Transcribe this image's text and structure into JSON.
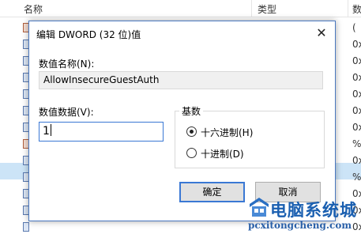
{
  "list": {
    "header": {
      "name": "名称",
      "type": "类型",
      "data": "数"
    },
    "row_values": [
      "(",
      "0x",
      "0x",
      "0x",
      "0x",
      "0x",
      "0x",
      "0x",
      "0x",
      "%",
      "0x",
      "%",
      "0x"
    ]
  },
  "dialog": {
    "title": "编辑 DWORD (32 位)值",
    "close_glyph": "✕",
    "name_label": "数值名称(N):",
    "name_value": "AllowInsecureGuestAuth",
    "data_label": "数值数据(V):",
    "data_value": "1",
    "base_label": "基数",
    "base_options": [
      {
        "label": "十六进制(H)",
        "checked": true
      },
      {
        "label": "十进制(D)",
        "checked": false
      }
    ],
    "ok_label": "确定",
    "cancel_label": "取消"
  },
  "watermark": {
    "title": "电脑系统城",
    "url": "pcxitongcheng.com"
  }
}
